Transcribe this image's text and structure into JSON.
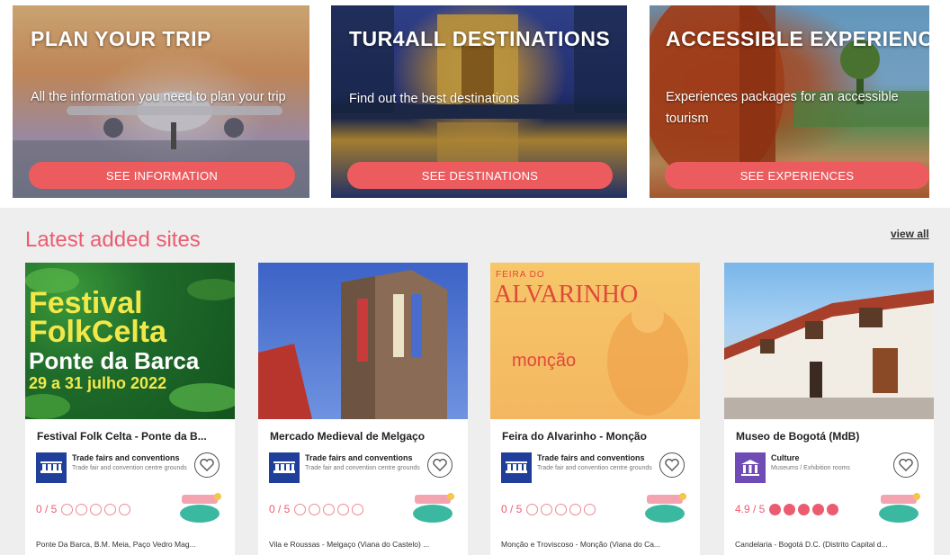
{
  "heroes": [
    {
      "title": "PLAN YOUR TRIP",
      "text": "All the information you need to plan your trip",
      "button": "SEE INFORMATION"
    },
    {
      "title": "TUR4ALL DESTINATIONS",
      "text": "Find out the best destinations",
      "button": "SEE DESTINATIONS"
    },
    {
      "title": "ACCESSIBLE EXPERIENCES",
      "text": "Experiences packages for an accessible tourism",
      "button": "SEE EXPERIENCES"
    }
  ],
  "latest": {
    "title": "Latest added sites",
    "view_all": "view all",
    "cards": [
      {
        "name": "Festival Folk Celta - Ponte da B...",
        "category": "Trade fairs and conventions",
        "subcategory": "Trade fair and convention centre grounds",
        "rating_text": "0 / 5",
        "rating_value": 0,
        "location": "Ponte Da Barca, B.M. Meia, Paço Vedro Mag...",
        "image_text": [
          "Festival",
          "FolkCelta",
          "Ponte da Barca",
          "29 a 31 julho 2022"
        ]
      },
      {
        "name": "Mercado Medieval de Melgaço",
        "category": "Trade fairs and conventions",
        "subcategory": "Trade fair and convention centre grounds",
        "rating_text": "0 / 5",
        "rating_value": 0,
        "location": "Vila e Roussas - Melgaço (Viana do Castelo) ..."
      },
      {
        "name": "Feira do Alvarinho - Monção",
        "category": "Trade fairs and conventions",
        "subcategory": "Trade fair and convention centre grounds",
        "rating_text": "0 / 5",
        "rating_value": 0,
        "location": "Monção e Troviscoso - Monção (Viana do Ca...",
        "image_text": [
          "FEIRA DO",
          "ALVARINHO",
          "monção"
        ]
      },
      {
        "name": "Museo de Bogotá (MdB)",
        "category": "Culture",
        "subcategory": "Museums / Exhibition rooms",
        "rating_text": "4.9 / 5",
        "rating_value": 4.9,
        "location": "Candelaria - Bogotá D.C. (Distrito Capital d..."
      }
    ]
  },
  "icons": {
    "category_trade": "trade-fair-icon",
    "category_culture": "museum-icon",
    "favorite": "heart-icon",
    "badge": "accessibility-badge-icon"
  },
  "colors": {
    "accent": "#ec5c70",
    "button": "#ec5c5f",
    "trade_icon_bg": "#1f3f9a",
    "culture_icon_bg": "#6f4bb5"
  }
}
